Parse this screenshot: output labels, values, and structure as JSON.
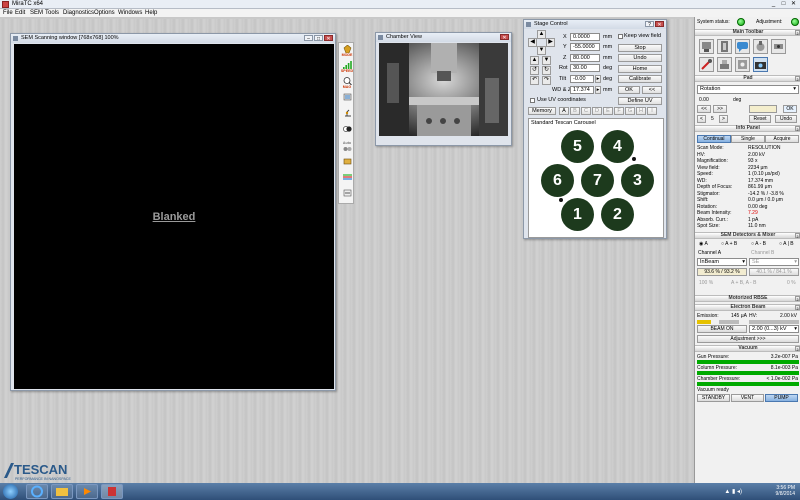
{
  "app": {
    "title": "MiraTC x64"
  },
  "menu": [
    "File",
    "Edit",
    "SEM",
    "Tools",
    "Diagnostics",
    "Options",
    "Windows",
    "Help"
  ],
  "sem_window": {
    "title": "SEM Scanning window [768x768] 100%",
    "status": "Blanked"
  },
  "tools": [
    {
      "label": "MODE",
      "icon": "mode-icon"
    },
    {
      "label": "SPEED",
      "icon": "speed-icon"
    },
    {
      "label": "MAG",
      "icon": "magnification-icon"
    },
    {
      "label": "",
      "icon": "scan-tool-icon"
    },
    {
      "label": "",
      "icon": "microscope-tool-icon"
    },
    {
      "label": "",
      "icon": "contrast-icon"
    },
    {
      "label": "Auto",
      "icon": "auto-icon"
    },
    {
      "label": "",
      "icon": "detector-icon"
    },
    {
      "label": "",
      "icon": "measure-icon"
    },
    {
      "label": "",
      "icon": "settings-icon"
    }
  ],
  "chamber": {
    "title": "Chamber View"
  },
  "stage": {
    "title": "Stage Control",
    "keep_view_field": "Keep view field",
    "x_label": "X",
    "x_value": "0.0000",
    "x_unit": "mm",
    "y_label": "Y",
    "y_value": "-55.0000",
    "y_unit": "mm",
    "z_label": "Z",
    "z_value": "80.000",
    "z_unit": "mm",
    "rot_label": "Rot",
    "rot_value": "30.00",
    "rot_unit": "deg",
    "tilt_label": "Tilt",
    "tilt_value": "-0.00",
    "tilt_unit": "deg",
    "wd_label": "WD & Z",
    "wd_value": "17.374",
    "wd_unit": "mm",
    "stop": "Stop",
    "undo": "Undo",
    "home": "Home",
    "calibrate": "Calibrate",
    "ok": "OK",
    "back": "<<",
    "use_uv": "Use UV coordinates",
    "define_uv": "Define UV",
    "memory": "Memory",
    "memory_slots": [
      "A",
      "B",
      "C",
      "D",
      "E",
      "F",
      "G",
      "H",
      "I"
    ],
    "carousel_title": "Standard Tescan Carousel",
    "stubs": [
      "5",
      "4",
      "6",
      "7",
      "3",
      "1",
      "2"
    ]
  },
  "panel": {
    "system_status": "System status:",
    "adjustment": "Adjustment:",
    "main_toolbar": "Main Toolbar",
    "pad": "Pad",
    "pad_mode": "Rotation",
    "pad_value": "0.00",
    "pad_unit": "deg",
    "pad_ok": "OK",
    "pad_step": "5",
    "reset": "Reset",
    "undo": "Undo",
    "info_panel": "Info Panel",
    "modes": [
      "Continual",
      "Single",
      "Acquire"
    ],
    "info_rows": [
      {
        "k": "Scan Mode:",
        "v": "RESOLUTION"
      },
      {
        "k": "HV:",
        "v": "2.00 kV"
      },
      {
        "k": "Magnification:",
        "v": "93 x"
      },
      {
        "k": "View field:",
        "v": "2234 μm"
      },
      {
        "k": "Speed:",
        "v": "1 (0.10 μs/pxl)"
      },
      {
        "k": "WD:",
        "v": "17.374 mm"
      },
      {
        "k": "Depth of Focus:",
        "v": "861.99 μm"
      },
      {
        "k": "Stigmator:",
        "v": "-14.2 % / -3.8 %"
      },
      {
        "k": "Shift:",
        "v": "0.0 μm / 0.0 μm"
      },
      {
        "k": "Rotation:",
        "v": "0.00 deg"
      },
      {
        "k": "Beam Intensity:",
        "v": "7.29"
      },
      {
        "k": "Absorb. Curr.:",
        "v": "1 pA"
      },
      {
        "k": "Spot Size:",
        "v": "11.0 nm"
      }
    ],
    "detectors_header": "SEM Detectors & Mixer",
    "det_options": [
      "A",
      "A + B",
      "A - B",
      "A | B"
    ],
    "channel_a": "Channel A",
    "channel_b": "Channel B",
    "det_a": "InBeam",
    "det_b": "SE",
    "det_a_level": "93.6 % / 93.2 %",
    "det_b_level": "40.1 % / 84.1 %",
    "det_a_mix": "100 %",
    "det_mix_formula": "A + B, A - B",
    "det_b_mix": "0 %",
    "motorized_header": "Motorized RBSE",
    "beam_header": "Electron Beam",
    "emission_label": "Emission:",
    "emission_value": "145 μA",
    "hv_label": "HV:",
    "hv_value": "2.00 kV",
    "beam_on": "BEAM ON",
    "hv_select": "2.00 (0...3) kV",
    "adjustment_btn": "Adjustment >>>",
    "vacuum_header": "Vacuum",
    "gun_pressure_label": "Gun Pressure:",
    "gun_pressure": "3.2e-007 Pa",
    "column_pressure_label": "Column Pressure:",
    "column_pressure": "8.1e-003 Pa",
    "chamber_pressure_label": "Chamber Pressure:",
    "chamber_pressure": "< 1.0e-002 Pa",
    "vacuum_status": "Vacuum ready",
    "standby": "STANDBY",
    "vent": "VENT",
    "pump": "PUMP"
  },
  "logo": {
    "name": "TESCAN",
    "tagline": "PERFORMANCE IN NANOSPACE"
  },
  "clock": {
    "time": "3:56 PM",
    "date": "9/8/2014"
  },
  "colors": {
    "status_ok": "#22aa22",
    "accent": "#2f4f78"
  }
}
